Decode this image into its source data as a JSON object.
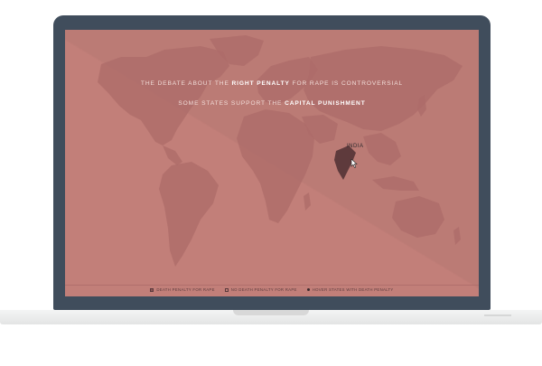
{
  "headline": {
    "line1_pre": "THE DEBATE ABOUT THE ",
    "line1_bold": "RIGHT PENALTY",
    "line1_post": " FOR RAPE IS CONTROVERSIAL",
    "line2_pre": "SOME STATES SUPPORT THE ",
    "line2_bold": "CAPITAL PUNISHMENT"
  },
  "hover": {
    "country": "INDIA"
  },
  "legend": [
    {
      "label": "DEATH PENALTY FOR RAPE",
      "marker": "filled-square"
    },
    {
      "label": "NO DEATH PENALTY FOR RAPE",
      "marker": "outline-square"
    },
    {
      "label": "HOVER STATES WITH DEATH PENALTY",
      "marker": "dot"
    }
  ],
  "colors": {
    "screen": "#c27f79",
    "land": "#ad6c69",
    "highlight": "#5e3a3c",
    "bezel": "#404d5c"
  },
  "icons": [
    "cursor-icon"
  ]
}
